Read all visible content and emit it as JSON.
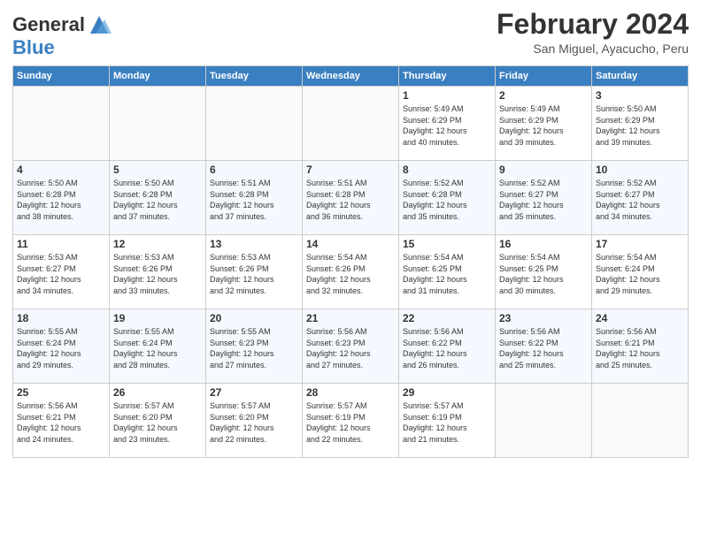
{
  "logo": {
    "line1": "General",
    "line2": "Blue"
  },
  "title": "February 2024",
  "subtitle": "San Miguel, Ayacucho, Peru",
  "headers": [
    "Sunday",
    "Monday",
    "Tuesday",
    "Wednesday",
    "Thursday",
    "Friday",
    "Saturday"
  ],
  "weeks": [
    [
      {
        "day": "",
        "info": ""
      },
      {
        "day": "",
        "info": ""
      },
      {
        "day": "",
        "info": ""
      },
      {
        "day": "",
        "info": ""
      },
      {
        "day": "1",
        "info": "Sunrise: 5:49 AM\nSunset: 6:29 PM\nDaylight: 12 hours\nand 40 minutes."
      },
      {
        "day": "2",
        "info": "Sunrise: 5:49 AM\nSunset: 6:29 PM\nDaylight: 12 hours\nand 39 minutes."
      },
      {
        "day": "3",
        "info": "Sunrise: 5:50 AM\nSunset: 6:29 PM\nDaylight: 12 hours\nand 39 minutes."
      }
    ],
    [
      {
        "day": "4",
        "info": "Sunrise: 5:50 AM\nSunset: 6:28 PM\nDaylight: 12 hours\nand 38 minutes."
      },
      {
        "day": "5",
        "info": "Sunrise: 5:50 AM\nSunset: 6:28 PM\nDaylight: 12 hours\nand 37 minutes."
      },
      {
        "day": "6",
        "info": "Sunrise: 5:51 AM\nSunset: 6:28 PM\nDaylight: 12 hours\nand 37 minutes."
      },
      {
        "day": "7",
        "info": "Sunrise: 5:51 AM\nSunset: 6:28 PM\nDaylight: 12 hours\nand 36 minutes."
      },
      {
        "day": "8",
        "info": "Sunrise: 5:52 AM\nSunset: 6:28 PM\nDaylight: 12 hours\nand 35 minutes."
      },
      {
        "day": "9",
        "info": "Sunrise: 5:52 AM\nSunset: 6:27 PM\nDaylight: 12 hours\nand 35 minutes."
      },
      {
        "day": "10",
        "info": "Sunrise: 5:52 AM\nSunset: 6:27 PM\nDaylight: 12 hours\nand 34 minutes."
      }
    ],
    [
      {
        "day": "11",
        "info": "Sunrise: 5:53 AM\nSunset: 6:27 PM\nDaylight: 12 hours\nand 34 minutes."
      },
      {
        "day": "12",
        "info": "Sunrise: 5:53 AM\nSunset: 6:26 PM\nDaylight: 12 hours\nand 33 minutes."
      },
      {
        "day": "13",
        "info": "Sunrise: 5:53 AM\nSunset: 6:26 PM\nDaylight: 12 hours\nand 32 minutes."
      },
      {
        "day": "14",
        "info": "Sunrise: 5:54 AM\nSunset: 6:26 PM\nDaylight: 12 hours\nand 32 minutes."
      },
      {
        "day": "15",
        "info": "Sunrise: 5:54 AM\nSunset: 6:25 PM\nDaylight: 12 hours\nand 31 minutes."
      },
      {
        "day": "16",
        "info": "Sunrise: 5:54 AM\nSunset: 6:25 PM\nDaylight: 12 hours\nand 30 minutes."
      },
      {
        "day": "17",
        "info": "Sunrise: 5:54 AM\nSunset: 6:24 PM\nDaylight: 12 hours\nand 29 minutes."
      }
    ],
    [
      {
        "day": "18",
        "info": "Sunrise: 5:55 AM\nSunset: 6:24 PM\nDaylight: 12 hours\nand 29 minutes."
      },
      {
        "day": "19",
        "info": "Sunrise: 5:55 AM\nSunset: 6:24 PM\nDaylight: 12 hours\nand 28 minutes."
      },
      {
        "day": "20",
        "info": "Sunrise: 5:55 AM\nSunset: 6:23 PM\nDaylight: 12 hours\nand 27 minutes."
      },
      {
        "day": "21",
        "info": "Sunrise: 5:56 AM\nSunset: 6:23 PM\nDaylight: 12 hours\nand 27 minutes."
      },
      {
        "day": "22",
        "info": "Sunrise: 5:56 AM\nSunset: 6:22 PM\nDaylight: 12 hours\nand 26 minutes."
      },
      {
        "day": "23",
        "info": "Sunrise: 5:56 AM\nSunset: 6:22 PM\nDaylight: 12 hours\nand 25 minutes."
      },
      {
        "day": "24",
        "info": "Sunrise: 5:56 AM\nSunset: 6:21 PM\nDaylight: 12 hours\nand 25 minutes."
      }
    ],
    [
      {
        "day": "25",
        "info": "Sunrise: 5:56 AM\nSunset: 6:21 PM\nDaylight: 12 hours\nand 24 minutes."
      },
      {
        "day": "26",
        "info": "Sunrise: 5:57 AM\nSunset: 6:20 PM\nDaylight: 12 hours\nand 23 minutes."
      },
      {
        "day": "27",
        "info": "Sunrise: 5:57 AM\nSunset: 6:20 PM\nDaylight: 12 hours\nand 22 minutes."
      },
      {
        "day": "28",
        "info": "Sunrise: 5:57 AM\nSunset: 6:19 PM\nDaylight: 12 hours\nand 22 minutes."
      },
      {
        "day": "29",
        "info": "Sunrise: 5:57 AM\nSunset: 6:19 PM\nDaylight: 12 hours\nand 21 minutes."
      },
      {
        "day": "",
        "info": ""
      },
      {
        "day": "",
        "info": ""
      }
    ]
  ]
}
